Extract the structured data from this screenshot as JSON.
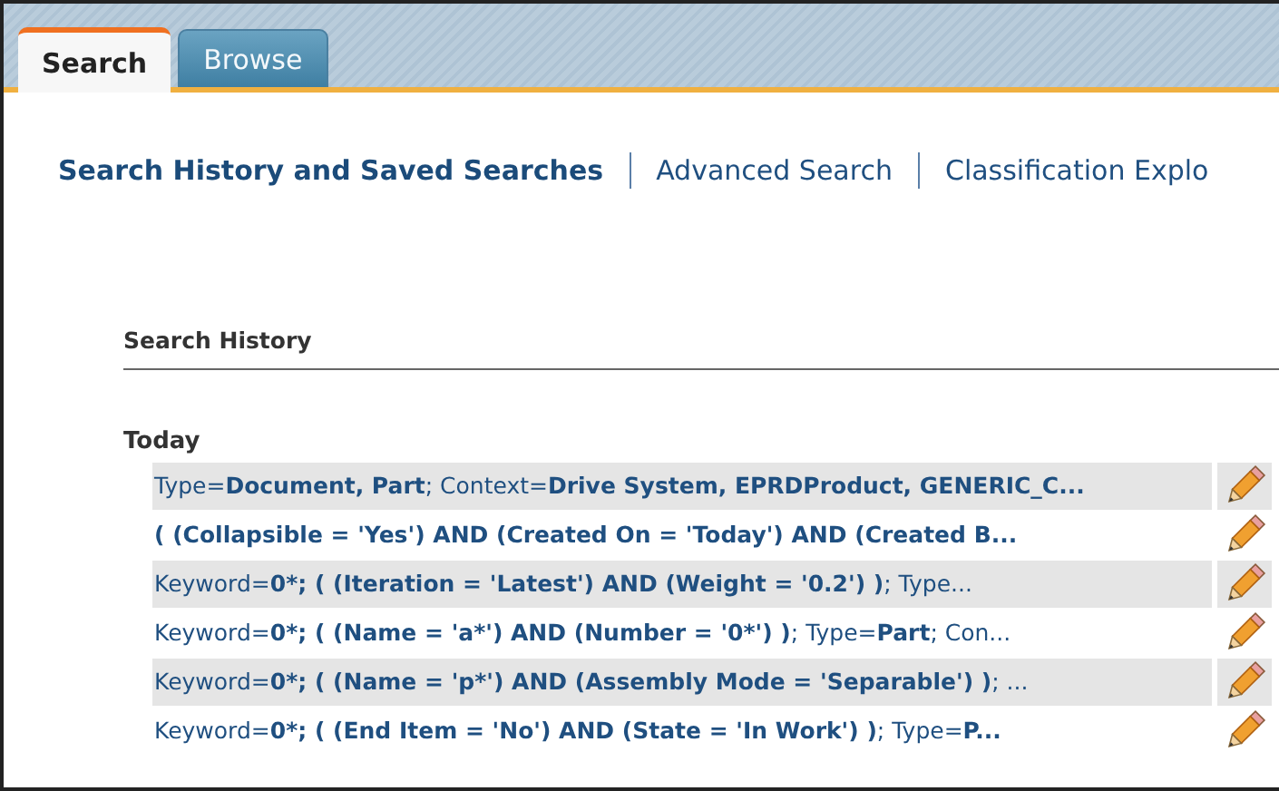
{
  "tabs": [
    {
      "label": "Search",
      "selected": true
    },
    {
      "label": "Browse",
      "selected": false
    }
  ],
  "nav_links": [
    {
      "label": "Search History and Saved Searches",
      "selected": true
    },
    {
      "label": "Advanced Search",
      "selected": false
    },
    {
      "label": "Classification Explo",
      "selected": false
    }
  ],
  "section_title": "Search History",
  "group_label": "Today",
  "history": [
    {
      "text": "Type=**Document, Part**; Context=**Drive System, EPRDProduct, GENERIC_C...**",
      "bold": false
    },
    {
      "text": "( (Collapsible = 'Yes') AND (Created On = 'Today') AND (Created B...",
      "bold": true
    },
    {
      "text": "Keyword=**0*; ( (Iteration = 'Latest') AND (Weight = '0.2') )**; Type...",
      "bold": false
    },
    {
      "text": "Keyword=**0*; ( (Name = 'a*') AND (Number = '0*') )**; Type=**Part**; Con...",
      "bold": false
    },
    {
      "text": "Keyword=**0*; ( (Name = 'p*') AND (Assembly Mode = 'Separable') )**; ...",
      "bold": false
    },
    {
      "text": "Keyword=**0*; ( (End Item = 'No') AND (State = 'In Work') )**; Type=**P...**",
      "bold": false
    }
  ]
}
